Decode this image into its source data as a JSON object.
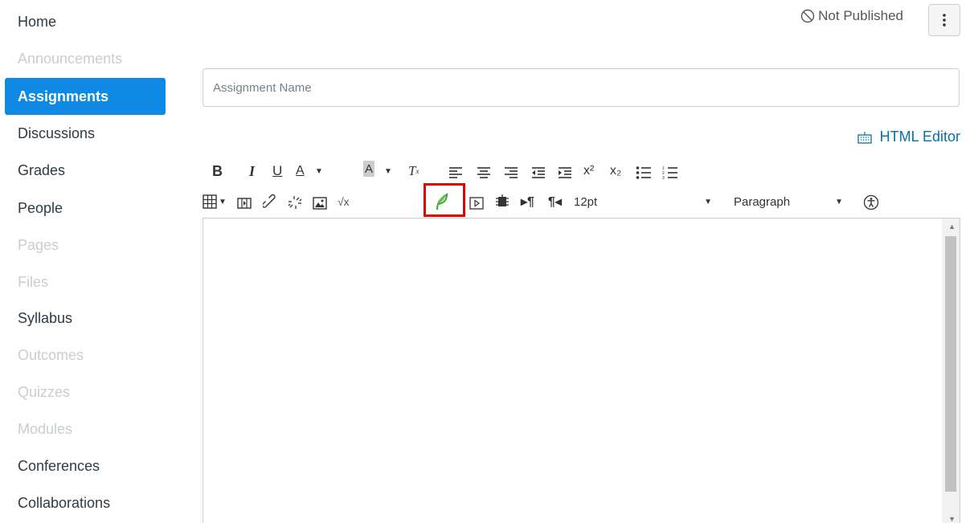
{
  "sidebar": {
    "items": [
      {
        "label": "Home",
        "state": "enabled"
      },
      {
        "label": "Announcements",
        "state": "disabled"
      },
      {
        "label": "Assignments",
        "state": "active"
      },
      {
        "label": "Discussions",
        "state": "enabled"
      },
      {
        "label": "Grades",
        "state": "enabled"
      },
      {
        "label": "People",
        "state": "enabled"
      },
      {
        "label": "Pages",
        "state": "disabled"
      },
      {
        "label": "Files",
        "state": "disabled"
      },
      {
        "label": "Syllabus",
        "state": "enabled"
      },
      {
        "label": "Outcomes",
        "state": "disabled"
      },
      {
        "label": "Quizzes",
        "state": "disabled"
      },
      {
        "label": "Modules",
        "state": "disabled"
      },
      {
        "label": "Conferences",
        "state": "enabled"
      },
      {
        "label": "Collaborations",
        "state": "enabled"
      }
    ]
  },
  "header": {
    "status_label": "Not Published",
    "status_icon": "circle-slash-icon",
    "more_icon": "kebab-menu-icon"
  },
  "form": {
    "name_placeholder": "Assignment Name",
    "name_value": ""
  },
  "editor": {
    "html_editor_label": "HTML Editor",
    "font_size_value": "12pt",
    "block_format_value": "Paragraph"
  },
  "toolbar": {
    "bold_label": "B",
    "italic_label": "I",
    "underline_label": "U",
    "text_color_label": "A",
    "bg_color_label": "A",
    "superscript_label": "x²",
    "subscript_label": "x₂"
  },
  "colors": {
    "accent": "#0e8ae4",
    "link": "#0770a3",
    "highlight": "#e60000",
    "disabled_text": "#c7cdd1"
  }
}
